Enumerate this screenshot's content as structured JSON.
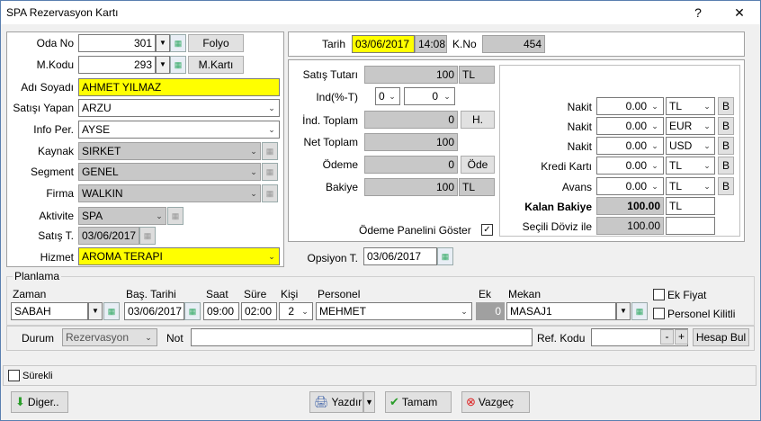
{
  "window": {
    "title": "SPA Rezervasyon Kartı",
    "help": "?",
    "close": "✕"
  },
  "left": {
    "oda_no_label": "Oda No",
    "oda_no_value": "301",
    "folyo_button": "Folyo",
    "mkodu_label": "M.Kodu",
    "mkodu_value": "293",
    "mkarti_button": "M.Kartı",
    "adi_soyadi_label": "Adı Soyadı",
    "adi_soyadi_value": "AHMET YILMAZ",
    "satisi_yapan_label": "Satışı Yapan",
    "satisi_yapan_value": "ARZU",
    "info_per_label": "Info Per.",
    "info_per_value": "AYSE",
    "kaynak_label": "Kaynak",
    "kaynak_value": "SIRKET",
    "segment_label": "Segment",
    "segment_value": "GENEL",
    "firma_label": "Firma",
    "firma_value": "WALKIN",
    "aktivite_label": "Aktivite",
    "aktivite_value": "SPA",
    "satis_t_label": "Satış T.",
    "satis_t_value": "03/06/2017",
    "hizmet_label": "Hizmet",
    "hizmet_value": "AROMA TERAPI"
  },
  "top": {
    "tarih_label": "Tarih",
    "tarih_value": "03/06/2017",
    "saat_value": "14:08",
    "kno_label": "K.No",
    "kno_value": "454"
  },
  "mid": {
    "satis_tutari_label": "Satış Tutarı",
    "satis_tutari_value": "100",
    "satis_tutari_cur": "TL",
    "ind_label": "Ind(%-T)",
    "ind_pct": "0",
    "ind_amt": "0",
    "ind_toplam_label": "İnd. Toplam",
    "ind_toplam_value": "0",
    "h_button": "H.",
    "net_toplam_label": "Net Toplam",
    "net_toplam_value": "100",
    "odeme_label": "Ödeme",
    "odeme_value": "0",
    "ode_button": "Öde",
    "bakiye_label": "Bakiye",
    "bakiye_value": "100",
    "bakiye_cur": "TL",
    "odeme_panel_label": "Ödeme Panelini Göster",
    "odeme_panel_checked": "✓",
    "opsiyon_label": "Opsiyon T.",
    "opsiyon_value": "03/06/2017"
  },
  "payments": {
    "rows": [
      {
        "label": "Nakit",
        "amount": "0.00",
        "currency": "TL",
        "b": "B"
      },
      {
        "label": "Nakit",
        "amount": "0.00",
        "currency": "EUR",
        "b": "B"
      },
      {
        "label": "Nakit",
        "amount": "0.00",
        "currency": "USD",
        "b": "B"
      },
      {
        "label": "Kredi Kartı",
        "amount": "0.00",
        "currency": "TL",
        "b": "B"
      },
      {
        "label": "Avans",
        "amount": "0.00",
        "currency": "TL",
        "b": "B"
      }
    ],
    "kalan_label": "Kalan Bakiye",
    "kalan_value": "100.00",
    "kalan_cur": "TL",
    "secili_label": "Seçili Döviz ile",
    "secili_value": "100.00"
  },
  "plan": {
    "group_label": "Planlama",
    "zaman_label": "Zaman",
    "zaman_value": "SABAH",
    "bas_label": "Baş. Tarihi",
    "bas_value": "03/06/2017",
    "saat_label": "Saat",
    "saat_value": "09:00",
    "sure_label": "Süre",
    "sure_value": "02:00",
    "kisi_label": "Kişi",
    "kisi_value": "2",
    "personel_label": "Personel",
    "personel_value": "MEHMET",
    "ek_label": "Ek",
    "ek_value": "0",
    "mekan_label": "Mekan",
    "mekan_value": "MASAJ1",
    "ek_fiyat_label": "Ek Fiyat",
    "personel_kilitli_label": "Personel Kilitli"
  },
  "status": {
    "durum_label": "Durum",
    "durum_value": "Rezervasyon",
    "not_label": "Not",
    "not_value": "",
    "ref_label": "Ref. Kodu",
    "ref_value": "",
    "minus": "-",
    "plus": "+",
    "hesap_button": "Hesap Bul"
  },
  "footer": {
    "surekli_label": "Sürekli",
    "diger_button": "Diger..",
    "yazdir_button": "Yazdır",
    "tamam_button": "Tamam",
    "vazgec_button": "Vazgeç"
  }
}
